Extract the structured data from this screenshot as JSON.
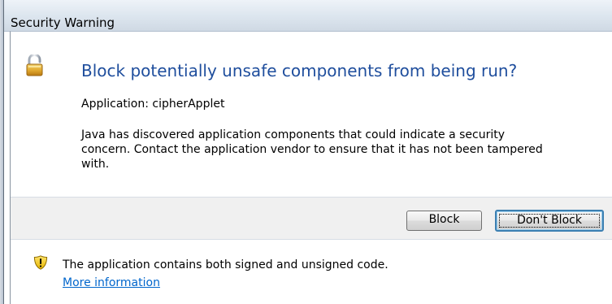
{
  "window": {
    "title": "Security Warning"
  },
  "dialog": {
    "heading": "Block potentially unsafe components from being run?",
    "application_line": "Application: cipherApplet",
    "description_lines": [
      "Java has discovered application components that could indicate a security",
      "concern. Contact the application vendor to ensure that it has not been tampered",
      "with."
    ],
    "heading_color": "#1f4e9d",
    "lock_icon": "unlocked-padlock-icon"
  },
  "buttons": {
    "block_label": "Block",
    "dont_block_label": "Don't Block",
    "default_button": "dont_block"
  },
  "footer": {
    "icon": "warning-shield-icon",
    "message": "The application contains both signed and unsigned code.",
    "link_text": "More information",
    "link_color": "#0066cc"
  }
}
